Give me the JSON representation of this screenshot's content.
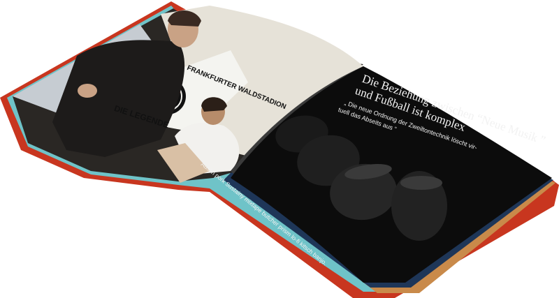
{
  "colors": {
    "cover_red": "#c8361f",
    "cover_navy": "#1e3658",
    "cover_orange": "#c98a4a",
    "cover_teal": "#6fc3c8",
    "cover_blue": "#2e7cc0",
    "page_black": "#0c0c0c",
    "wall": "#e6e2d8"
  },
  "magazine": {
    "right_page": {
      "headline_line1": "Die Beziehung zwischen  “Neue Musik ”",
      "headline_line2": "und Fußball ist komplex",
      "subtitle_line1": "„ Die neue Ordnung der Zweiltontechnik löscht vir-",
      "subtitle_line2": "tuell das  Abseits aus “",
      "body_line1": "Austin pork Sustainy mixtape butcher prism lo-fi kitsch banjo.",
      "body_line2": ""
    },
    "left_page": {
      "banner_top": "FRANKFURTER WALDSTADION",
      "banner_bottom": "DIE LEGENDE"
    }
  }
}
